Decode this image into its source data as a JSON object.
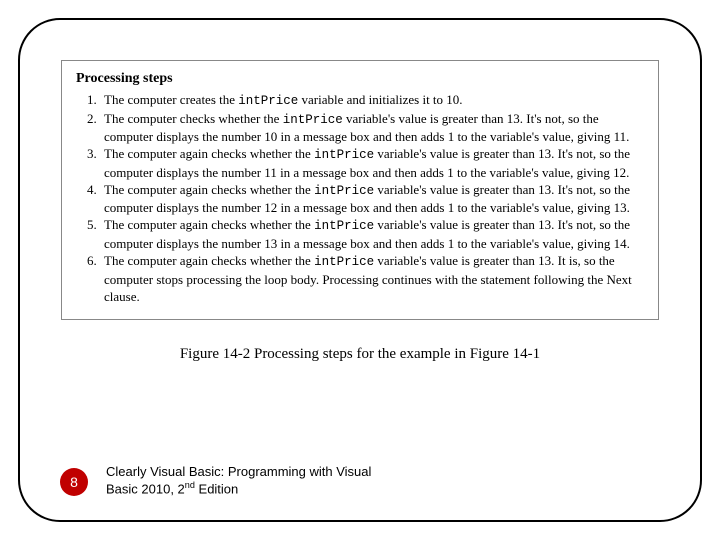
{
  "figure": {
    "heading": "Processing steps",
    "steps": [
      {
        "pre": "The computer creates the ",
        "code": "intPrice",
        "post": " variable and initializes it to 10."
      },
      {
        "pre": "The computer checks whether the ",
        "code": "intPrice",
        "post": " variable's value is greater than 13. It's not, so the computer displays the number 10 in a message box and then adds 1 to the variable's value, giving 11."
      },
      {
        "pre": "The computer again checks whether the ",
        "code": "intPrice",
        "post": " variable's value is greater than 13. It's not, so the computer displays the number 11 in a message box and then adds 1 to the variable's value, giving 12."
      },
      {
        "pre": "The computer again checks whether the ",
        "code": "intPrice",
        "post": " variable's value is greater than 13. It's not, so the computer displays the number 12 in a message box and then adds 1 to the variable's value, giving 13."
      },
      {
        "pre": "The computer again checks whether the ",
        "code": "intPrice",
        "post": " variable's value is greater than 13. It's not, so the computer displays the number 13 in a message box and then adds 1 to the variable's value, giving 14."
      },
      {
        "pre": "The computer again checks whether the ",
        "code": "intPrice",
        "post": " variable's value is greater than 13. It is, so the computer stops processing the loop body. Processing continues with the statement following the Next clause."
      }
    ]
  },
  "caption": "Figure 14-2 Processing steps for the example in Figure 14-1",
  "page_number": "8",
  "book_line1": "Clearly Visual Basic: Programming with Visual",
  "book_line2_pre": "Basic 2010, 2",
  "book_line2_sup": "nd",
  "book_line2_post": " Edition"
}
